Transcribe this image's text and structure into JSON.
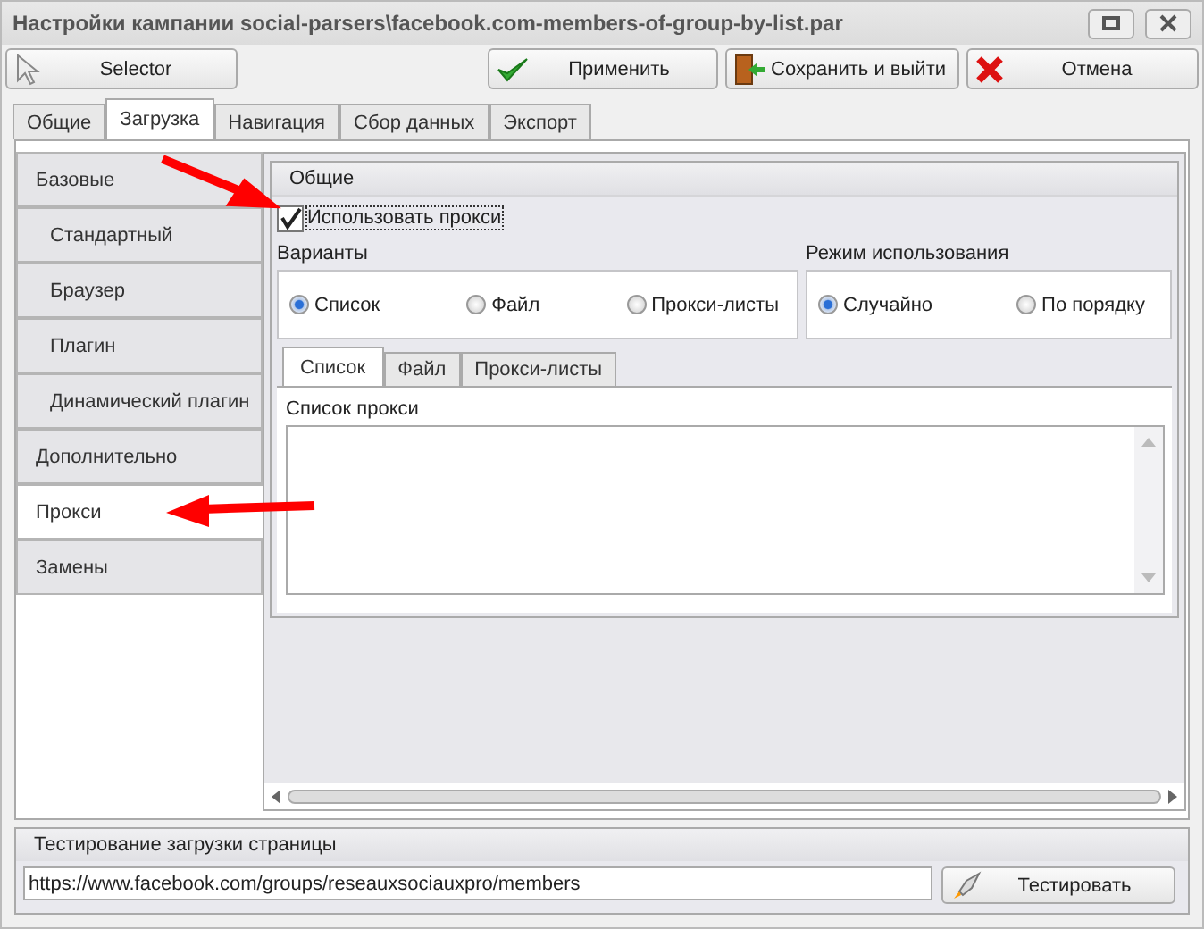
{
  "window": {
    "title": "Настройки кампании social-parsers\\facebook.com-members-of-group-by-list.par"
  },
  "toolbar": {
    "selector": "Selector",
    "buttons": [
      {
        "label": "Применить",
        "kind": "apply"
      },
      {
        "label": "Сохранить и выйти",
        "kind": "save_exit"
      },
      {
        "label": "Отмена",
        "kind": "cancel"
      }
    ]
  },
  "tabs": [
    {
      "label": "Общие",
      "selected": false
    },
    {
      "label": "Загрузка",
      "selected": true
    },
    {
      "label": "Навигация",
      "selected": false
    },
    {
      "label": "Сбор данных",
      "selected": false
    },
    {
      "label": "Экспорт",
      "selected": false
    }
  ],
  "sidebar": {
    "items": [
      {
        "label": "Базовые",
        "selected": false,
        "children": [
          {
            "label": "Стандартный",
            "selected": false
          },
          {
            "label": "Браузер",
            "selected": false
          },
          {
            "label": "Плагин",
            "selected": false
          },
          {
            "label": "Динамический плагин",
            "selected": false
          }
        ]
      },
      {
        "label": "Дополнительно",
        "selected": false
      },
      {
        "label": "Прокси",
        "selected": true
      },
      {
        "label": "Замены",
        "selected": false
      }
    ]
  },
  "general_group": {
    "title": "Общие",
    "use_proxy": {
      "label": "Использовать прокси",
      "checked": true
    },
    "variants": {
      "label": "Варианты",
      "options": [
        {
          "label": "Список",
          "selected": true
        },
        {
          "label": "Файл",
          "selected": false
        },
        {
          "label": "Прокси-листы",
          "selected": false
        }
      ]
    },
    "mode": {
      "label": "Режим использования",
      "options": [
        {
          "label": "Случайно",
          "selected": true
        },
        {
          "label": "По порядку",
          "selected": false
        }
      ]
    },
    "subtabs": [
      {
        "label": "Список",
        "selected": true
      },
      {
        "label": "Файл",
        "selected": false
      },
      {
        "label": "Прокси-листы",
        "selected": false
      }
    ],
    "list_label": "Список прокси"
  },
  "test_group": {
    "title": "Тестирование загрузки страницы",
    "url": "https://www.facebook.com/groups/reseauxsociauxpro/members",
    "button": "Тестировать"
  }
}
